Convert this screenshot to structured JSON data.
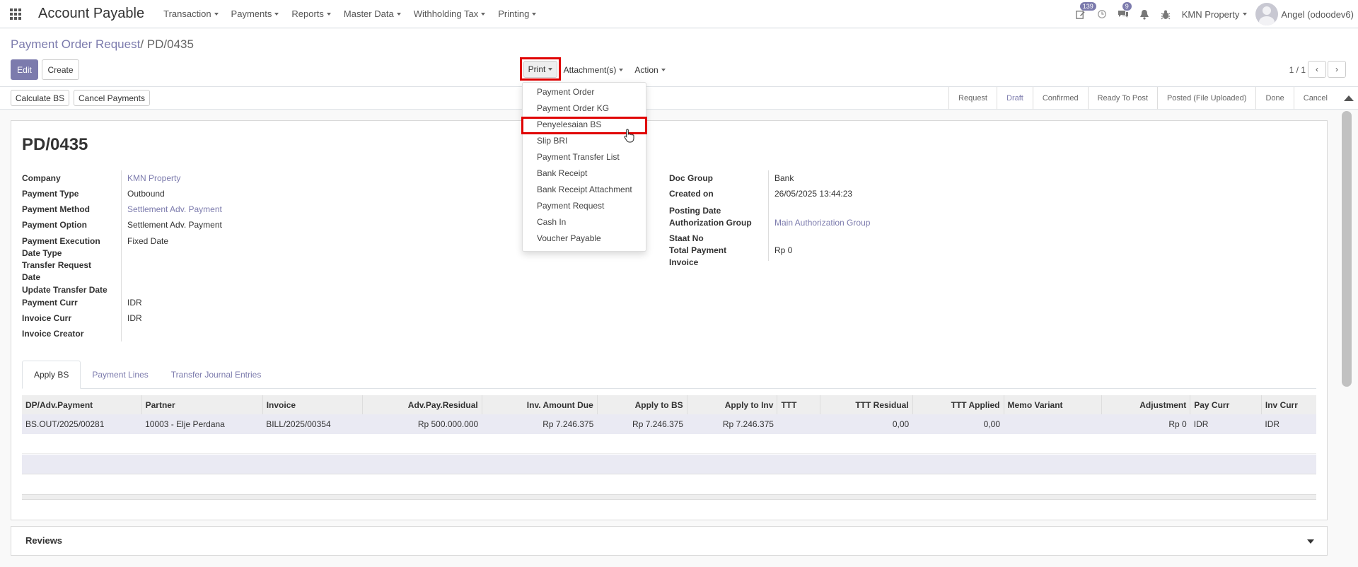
{
  "navbar": {
    "app_title": "Account Payable",
    "menus": [
      "Transaction",
      "Payments",
      "Reports",
      "Master Data",
      "Withholding Tax",
      "Printing"
    ],
    "activity_badge": "139",
    "messages_badge": "9",
    "company": "KMN Property",
    "user": "Angel (odoodev6)"
  },
  "breadcrumb": {
    "parent": "Payment Order Request",
    "separator": "/",
    "current": "PD/0435"
  },
  "buttons": {
    "edit": "Edit",
    "create": "Create",
    "print": "Print",
    "attachments": "Attachment(s)",
    "action": "Action",
    "calculate_bs": "Calculate BS",
    "cancel_payments": "Cancel Payments"
  },
  "pager": {
    "value": "1 / 1",
    "prev": "‹",
    "next": "›"
  },
  "status_steps": [
    "Request",
    "Draft",
    "Confirmed",
    "Ready To Post",
    "Posted (File Uploaded)",
    "Done",
    "Cancel"
  ],
  "record": {
    "title": "PD/0435",
    "left_fields": [
      {
        "label": "Company",
        "value": "KMN Property"
      },
      {
        "label": "Payment Type",
        "value": "Outbound"
      },
      {
        "label": "Payment Method",
        "value": "Settlement Adv. Payment"
      },
      {
        "label": "Payment Option",
        "value": "Settlement Adv. Payment"
      },
      {
        "label": "Payment Execution Date Type",
        "value": "Fixed Date"
      },
      {
        "label": "Transfer Request Date",
        "value": ""
      },
      {
        "label": "Update Transfer Date",
        "value": ""
      },
      {
        "label": "Payment Curr",
        "value": "IDR"
      },
      {
        "label": "Invoice Curr",
        "value": "IDR"
      },
      {
        "label": "Invoice Creator",
        "value": ""
      }
    ],
    "right_fields": [
      {
        "label": "Doc Group",
        "value": "Bank"
      },
      {
        "label": "Created on",
        "value": "26/05/2025 13:44:23"
      },
      {
        "label": "Posting Date",
        "value": ""
      },
      {
        "label": "Authorization Group",
        "value": "Main Authorization Group"
      },
      {
        "label": "Staat No",
        "value": ""
      },
      {
        "label": "Total Payment Invoice",
        "value": "Rp 0"
      }
    ]
  },
  "tabs": [
    "Apply BS",
    "Payment Lines",
    "Transfer Journal Entries"
  ],
  "table": {
    "headers": [
      "DP/Adv.Payment",
      "Partner",
      "Invoice",
      "Adv.Pay.Residual",
      "Inv. Amount Due",
      "Apply to BS",
      "Apply to Inv",
      "TTT",
      "TTT Residual",
      "TTT Applied",
      "Memo Variant",
      "Adjustment",
      "Pay Curr",
      "Inv Curr"
    ],
    "rows": [
      [
        "BS.OUT/2025/00281",
        "10003 - Elje Perdana",
        "BILL/2025/00354",
        "Rp 500.000.000",
        "Rp 7.246.375",
        "Rp 7.246.375",
        "Rp 7.246.375",
        "",
        "0,00",
        "0,00",
        "",
        "Rp 0",
        "IDR",
        "IDR"
      ]
    ]
  },
  "reviews": {
    "title": "Reviews"
  },
  "print_menu": {
    "items": [
      "Payment Order",
      "Payment Order KG",
      "Penyelesaian BS",
      "Slip BRI",
      "Payment Transfer List",
      "Bank Receipt",
      "Bank Receipt Attachment",
      "Payment Request",
      "Cash In",
      "Voucher Payable"
    ],
    "highlighted": "Penyelesaian BS"
  },
  "colors": {
    "accent": "#7c7bad",
    "highlight": "#e00000"
  }
}
